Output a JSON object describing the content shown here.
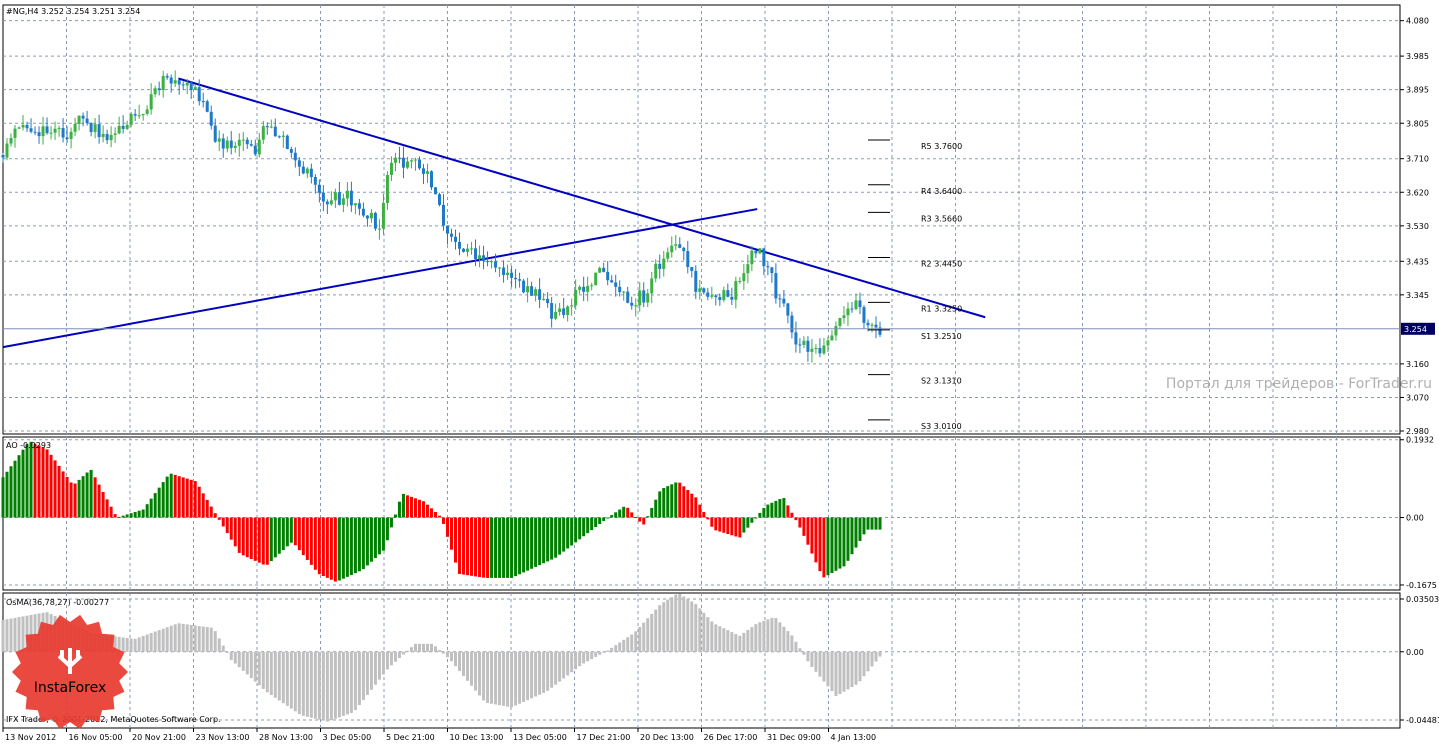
{
  "chart_data": [
    {
      "type": "candlestick",
      "title": "#NG,H4 3.252 3.254 3.251 3.254",
      "ylim": [
        2.972,
        4.122
      ],
      "y_ticks": [
        2.98,
        3.07,
        3.16,
        3.345,
        3.435,
        3.53,
        3.62,
        3.71,
        3.805,
        3.895,
        3.985,
        4.08
      ],
      "y_tick_labels": [
        "2.980",
        "3.070",
        "3.160",
        "3.345",
        "3.435",
        "3.530",
        "3.620",
        "3.710",
        "3.805",
        "3.895",
        "3.985",
        "4.080"
      ],
      "x_tick_labels": [
        "13 Nov 2012",
        "16 Nov 05:00",
        "20 Nov 21:00",
        "23 Nov 13:00",
        "28 Nov 13:00",
        "3 Dec 05:00",
        "5 Dec 21:00",
        "10 Dec 13:00",
        "13 Dec 05:00",
        "17 Dec 21:00",
        "20 Dec 13:00",
        "26 Dec 17:00",
        "31 Dec 09:00",
        "4 Jan 13:00"
      ],
      "current_price": 3.254,
      "current_price_label": "3.254",
      "pivot_levels": [
        {
          "label": "R5 3.7600",
          "value": 3.76
        },
        {
          "label": "R4 3.6400",
          "value": 3.64
        },
        {
          "label": "R3 3.5660",
          "value": 3.566
        },
        {
          "label": "R2 3.4450",
          "value": 3.445
        },
        {
          "label": "R1 3.3250",
          "value": 3.325
        },
        {
          "label": "S1 3.2510",
          "value": 3.251
        },
        {
          "label": "S2 3.1310",
          "value": 3.131
        },
        {
          "label": "S3 3.0100",
          "value": 3.01
        }
      ],
      "trendlines": [
        {
          "name": "resistance",
          "from": {
            "bar": 0.2,
            "price": 3.925
          },
          "to": {
            "bar": 1.12,
            "price": 3.285
          }
        },
        {
          "name": "support",
          "from": {
            "bar": 0.0,
            "price": 3.205
          },
          "to": {
            "bar": 0.86,
            "price": 3.575
          }
        }
      ],
      "watermark": "Портал для трейдеров - ForTrader.ru",
      "close_path": [
        [
          0.0,
          3.72
        ],
        [
          0.02,
          3.8
        ],
        [
          0.04,
          3.79
        ],
        [
          0.06,
          3.78
        ],
        [
          0.075,
          3.76
        ],
        [
          0.09,
          3.83
        ],
        [
          0.11,
          3.77
        ],
        [
          0.13,
          3.78
        ],
        [
          0.15,
          3.83
        ],
        [
          0.165,
          3.86
        ],
        [
          0.18,
          3.92
        ],
        [
          0.2,
          3.91
        ],
        [
          0.215,
          3.9
        ],
        [
          0.23,
          3.86
        ],
        [
          0.245,
          3.75
        ],
        [
          0.26,
          3.74
        ],
        [
          0.275,
          3.75
        ],
        [
          0.29,
          3.73
        ],
        [
          0.3,
          3.8
        ],
        [
          0.31,
          3.79
        ],
        [
          0.325,
          3.75
        ],
        [
          0.335,
          3.68
        ],
        [
          0.35,
          3.67
        ],
        [
          0.36,
          3.6
        ],
        [
          0.375,
          3.6
        ],
        [
          0.39,
          3.61
        ],
        [
          0.405,
          3.58
        ],
        [
          0.42,
          3.55
        ],
        [
          0.43,
          3.53
        ],
        [
          0.44,
          3.71
        ],
        [
          0.455,
          3.7
        ],
        [
          0.47,
          3.7
        ],
        [
          0.485,
          3.66
        ],
        [
          0.495,
          3.6
        ],
        [
          0.505,
          3.52
        ],
        [
          0.52,
          3.47
        ],
        [
          0.535,
          3.46
        ],
        [
          0.55,
          3.45
        ],
        [
          0.565,
          3.42
        ],
        [
          0.58,
          3.4
        ],
        [
          0.595,
          3.36
        ],
        [
          0.61,
          3.34
        ],
        [
          0.625,
          3.3
        ],
        [
          0.64,
          3.31
        ],
        [
          0.655,
          3.35
        ],
        [
          0.67,
          3.37
        ],
        [
          0.685,
          3.41
        ],
        [
          0.695,
          3.39
        ],
        [
          0.705,
          3.35
        ],
        [
          0.72,
          3.33
        ],
        [
          0.735,
          3.35
        ],
        [
          0.745,
          3.42
        ],
        [
          0.755,
          3.45
        ],
        [
          0.765,
          3.47
        ],
        [
          0.78,
          3.44
        ],
        [
          0.79,
          3.37
        ],
        [
          0.8,
          3.34
        ],
        [
          0.81,
          3.33
        ],
        [
          0.82,
          3.35
        ],
        [
          0.83,
          3.34
        ],
        [
          0.845,
          3.4
        ],
        [
          0.855,
          3.46
        ],
        [
          0.865,
          3.45
        ],
        [
          0.875,
          3.4
        ],
        [
          0.885,
          3.32
        ],
        [
          0.895,
          3.3
        ],
        [
          0.905,
          3.22
        ],
        [
          0.92,
          3.19
        ],
        [
          0.935,
          3.21
        ],
        [
          0.945,
          3.23
        ],
        [
          0.96,
          3.3
        ],
        [
          0.975,
          3.32
        ],
        [
          0.985,
          3.25
        ],
        [
          1.0,
          3.254
        ]
      ]
    },
    {
      "type": "bar",
      "title": "AO -0.0293",
      "ylim": [
        -0.18,
        0.2
      ],
      "y_ticks": [
        0.1932,
        0.0,
        -0.1675
      ],
      "y_tick_labels": [
        "0.1932",
        "0.00",
        "-0.1675"
      ],
      "positive_color": "#008000",
      "negative_color": "#ff0000",
      "profile": [
        [
          0.0,
          0.1
        ],
        [
          0.03,
          0.19
        ],
        [
          0.05,
          0.17
        ],
        [
          0.08,
          0.08
        ],
        [
          0.1,
          0.12
        ],
        [
          0.13,
          0.0
        ],
        [
          0.16,
          0.02
        ],
        [
          0.19,
          0.11
        ],
        [
          0.22,
          0.09
        ],
        [
          0.245,
          0.0
        ],
        [
          0.27,
          -0.09
        ],
        [
          0.3,
          -0.12
        ],
        [
          0.33,
          -0.06
        ],
        [
          0.36,
          -0.14
        ],
        [
          0.38,
          -0.16
        ],
        [
          0.41,
          -0.13
        ],
        [
          0.435,
          -0.08
        ],
        [
          0.455,
          0.06
        ],
        [
          0.48,
          0.04
        ],
        [
          0.5,
          0.0
        ],
        [
          0.52,
          -0.14
        ],
        [
          0.55,
          -0.15
        ],
        [
          0.58,
          -0.15
        ],
        [
          0.6,
          -0.13
        ],
        [
          0.63,
          -0.1
        ],
        [
          0.66,
          -0.05
        ],
        [
          0.69,
          0.0
        ],
        [
          0.71,
          0.03
        ],
        [
          0.73,
          -0.02
        ],
        [
          0.75,
          0.07
        ],
        [
          0.77,
          0.09
        ],
        [
          0.79,
          0.05
        ],
        [
          0.81,
          -0.03
        ],
        [
          0.84,
          -0.05
        ],
        [
          0.87,
          0.03
        ],
        [
          0.89,
          0.05
        ],
        [
          0.91,
          -0.03
        ],
        [
          0.935,
          -0.15
        ],
        [
          0.96,
          -0.12
        ],
        [
          0.985,
          -0.03
        ],
        [
          1.0,
          -0.03
        ]
      ]
    },
    {
      "type": "bar",
      "title": "OsMA(36,78,27) -0.00277",
      "ylim": [
        -0.0048,
        0.0037
      ],
      "y_ticks": [
        0.03503,
        0.0,
        -0.04481
      ],
      "y_tick_labels": [
        "0.03503",
        "0.00",
        "-0.04481"
      ],
      "bar_color": "#c0c0c0",
      "profile": [
        [
          0.0,
          0.002
        ],
        [
          0.05,
          0.0025
        ],
        [
          0.1,
          0.0012
        ],
        [
          0.15,
          0.0008
        ],
        [
          0.2,
          0.0018
        ],
        [
          0.24,
          0.0015
        ],
        [
          0.26,
          -0.0005
        ],
        [
          0.3,
          -0.0025
        ],
        [
          0.34,
          -0.004
        ],
        [
          0.37,
          -0.0044
        ],
        [
          0.4,
          -0.0038
        ],
        [
          0.44,
          -0.001
        ],
        [
          0.47,
          0.0005
        ],
        [
          0.49,
          0.0005
        ],
        [
          0.51,
          -0.0005
        ],
        [
          0.55,
          -0.0032
        ],
        [
          0.58,
          -0.0035
        ],
        [
          0.62,
          -0.0025
        ],
        [
          0.66,
          -0.0008
        ],
        [
          0.69,
          0.0001
        ],
        [
          0.72,
          0.0012
        ],
        [
          0.75,
          0.003
        ],
        [
          0.77,
          0.0037
        ],
        [
          0.79,
          0.003
        ],
        [
          0.81,
          0.0018
        ],
        [
          0.84,
          0.001
        ],
        [
          0.86,
          0.0018
        ],
        [
          0.88,
          0.0022
        ],
        [
          0.9,
          0.001
        ],
        [
          0.92,
          -0.0008
        ],
        [
          0.95,
          -0.0028
        ],
        [
          0.975,
          -0.002
        ],
        [
          1.0,
          -0.0003
        ]
      ]
    }
  ],
  "footer_text": "IFX Trader, © 2001-2012, MetaQuotes Software Corp.",
  "logo_text": "InstaForex",
  "colors": {
    "grid": "#8a9bb8",
    "up_candle": "#3cb043",
    "down_candle": "#1f78c8",
    "trendline": "#0000c0",
    "price_line": "#7f8fb8",
    "price_tag_bg": "#000060",
    "logo_red": "#e8392f"
  }
}
